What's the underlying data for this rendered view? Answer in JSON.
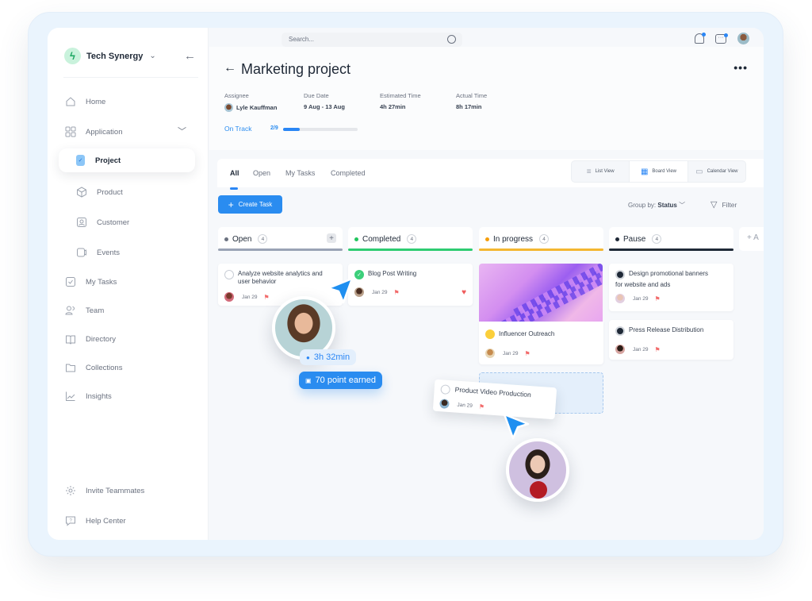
{
  "workspace": {
    "name": "Tech Synergy"
  },
  "sidebar": {
    "items": [
      {
        "label": "Home",
        "icon": "home-icon"
      },
      {
        "label": "Application",
        "icon": "grid-icon"
      },
      {
        "label": "Project",
        "icon": "clipboard-icon",
        "active": true
      },
      {
        "label": "Product",
        "icon": "cube-icon"
      },
      {
        "label": "Customer",
        "icon": "user-card-icon"
      },
      {
        "label": "Events",
        "icon": "video-icon"
      },
      {
        "label": "My Tasks",
        "icon": "checkbox-icon"
      },
      {
        "label": "Team",
        "icon": "team-icon"
      },
      {
        "label": "Directory",
        "icon": "book-icon"
      },
      {
        "label": "Collections",
        "icon": "folder-icon"
      },
      {
        "label": "Insights",
        "icon": "chart-icon"
      }
    ],
    "footer": [
      {
        "label": "Invite Teammates",
        "icon": "gear-icon"
      },
      {
        "label": "Help Center",
        "icon": "help-icon"
      }
    ]
  },
  "topbar": {
    "search_placeholder": "Search..."
  },
  "project": {
    "title": "Marketing project",
    "assignee_label": "Assignee",
    "assignee": "Lyle Kauffman",
    "due_label": "Due Date",
    "due": "9 Aug - 13 Aug",
    "est_label": "Estimated Time",
    "est": "4h 27min",
    "actual_label": "Actual Time",
    "actual": "8h 17min",
    "status": "On Track",
    "progress_text": "2/9",
    "progress": 0.22
  },
  "tabs": [
    "All",
    "Open",
    "My Tasks",
    "Completed"
  ],
  "views": [
    "List View",
    "Board View",
    "Calendar View"
  ],
  "toolbar": {
    "create_label": "Create Task",
    "groupby_label": "Group by:",
    "groupby_value": "Status",
    "filter_label": "Filter"
  },
  "columns": [
    {
      "name": "Open",
      "count": "4",
      "color": "#6b7280",
      "bar": "#9aa3b5"
    },
    {
      "name": "Completed",
      "count": "4",
      "color": "#22c55e",
      "bar": "#2ecc71"
    },
    {
      "name": "In progress",
      "count": "4",
      "color": "#f59e0b",
      "bar": "#f4b731"
    },
    {
      "name": "Pause",
      "count": "4",
      "color": "#1f2937",
      "bar": "#1f2937"
    }
  ],
  "add_column_label": "+ A",
  "cards": {
    "open1": {
      "title_a": "Analyze website analytics and",
      "title_b": "user behavior",
      "date": "Jan 29"
    },
    "done1": {
      "title": "Blog Post Writing",
      "date": "Jan 29"
    },
    "prog1": {
      "title": "Influencer Outreach",
      "date": "Jan 29"
    },
    "pause1": {
      "title_a": "Design promotional banners",
      "title_b": "for website and ads",
      "date": "Jan 29"
    },
    "pause2": {
      "title": "Press Release Distribution",
      "date": "Jan 29"
    },
    "drag": {
      "title": "Product Video Production",
      "date": "Jan 29"
    }
  },
  "overlay": {
    "time": "3h 32min",
    "points": "70 point earned"
  }
}
